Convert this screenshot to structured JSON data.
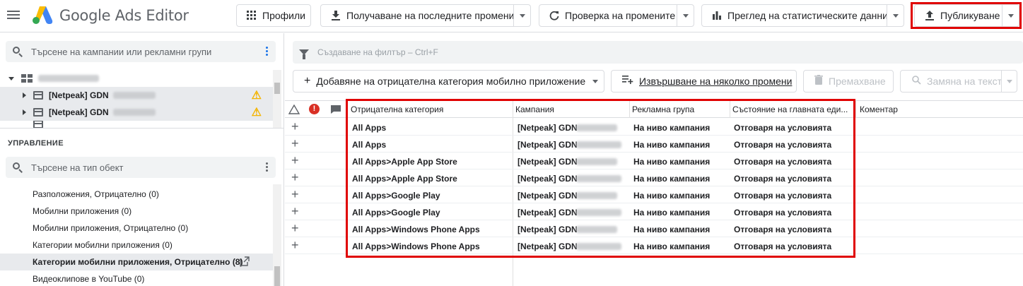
{
  "app": {
    "title": "Google Ads Editor"
  },
  "toolbar": {
    "profiles": "Профили",
    "get_changes": "Получаване на последните промени",
    "check_changes": "Проверка на промените",
    "view_stats": "Преглед на статистическите данни",
    "publish": "Публикуване"
  },
  "left": {
    "campaign_search_placeholder": "Търсене на кампании или рекламни групи",
    "tree": [
      {
        "label": "[Netpeak] GDN",
        "warning": true
      },
      {
        "label": "[Netpeak] GDN",
        "warning": true
      }
    ],
    "manage_title": "УПРАВЛЕНИЕ",
    "type_search_placeholder": "Търсене на тип обект",
    "types": [
      "Разположения, Отрицателно (0)",
      "Мобилни приложения (0)",
      "Мобилни приложения, Отрицателно (0)",
      "Категории мобилни приложения (0)",
      "Категории мобилни приложения, Отрицателно (8)",
      "Видеоклипове в YouTube (0)"
    ]
  },
  "main": {
    "filter_placeholder": "Създаване на филтър – Ctrl+F",
    "actions": {
      "add": "Добавяне на отрицателна категория мобилно приложение",
      "multi": "Извършване на няколко промени",
      "remove": "Премахване",
      "replace": "Замяна на текст"
    },
    "columns": [
      "Отрицателна категория",
      "Кампания",
      "Рекламна група",
      "Състояние на главната еди...",
      "Коментар"
    ],
    "rows": [
      {
        "category": "All Apps",
        "campaign": "[Netpeak] GDN",
        "adgroup": "На ниво кампания",
        "status": "Отговаря на условията"
      },
      {
        "category": "All Apps",
        "campaign": "[Netpeak] GDN",
        "adgroup": "На ниво кампания",
        "status": "Отговаря на условията"
      },
      {
        "category": "All Apps>Apple App Store",
        "campaign": "[Netpeak] GDN",
        "adgroup": "На ниво кампания",
        "status": "Отговаря на условията"
      },
      {
        "category": "All Apps>Apple App Store",
        "campaign": "[Netpeak] GDN",
        "adgroup": "На ниво кампания",
        "status": "Отговаря на условията"
      },
      {
        "category": "All Apps>Google Play",
        "campaign": "[Netpeak] GDN",
        "adgroup": "На ниво кампания",
        "status": "Отговаря на условията"
      },
      {
        "category": "All Apps>Google Play",
        "campaign": "[Netpeak] GDN",
        "adgroup": "На ниво кампания",
        "status": "Отговаря на условията"
      },
      {
        "category": "All Apps>Windows Phone Apps",
        "campaign": "[Netpeak] GDN",
        "adgroup": "На ниво кампания",
        "status": "Отговаря на условията"
      },
      {
        "category": "All Apps>Windows Phone Apps",
        "campaign": "[Netpeak] GDN",
        "adgroup": "На ниво кампания",
        "status": "Отговаря на условията"
      }
    ]
  },
  "colors": {
    "highlight": "#e00000",
    "warning": "#f4b400",
    "error": "#d93025"
  }
}
